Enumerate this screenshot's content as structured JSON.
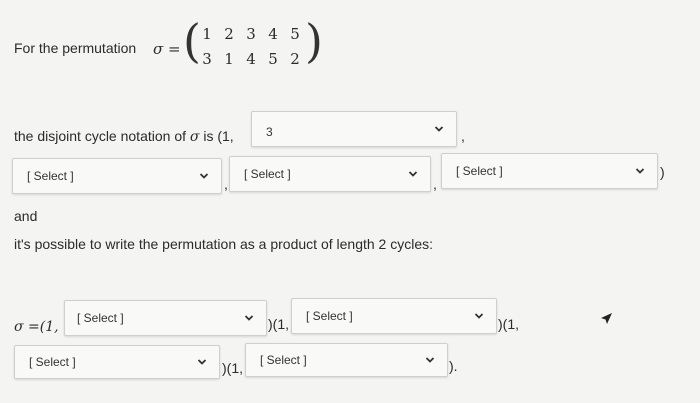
{
  "question": {
    "intro": "For the permutation",
    "sigma_eq": "σ =",
    "matrix_top": [
      "1",
      "2",
      "3",
      "4",
      "5"
    ],
    "matrix_bottom": [
      "3",
      "1",
      "4",
      "5",
      "2"
    ],
    "disjoint_prefix": "the disjoint cycle notation of",
    "disjoint_sigma": "σ",
    "disjoint_is": "is (1,",
    "and_text": "and",
    "product_text": "it's possible to write the permutation as a product of length 2 cycles:",
    "product_prefix": "σ =(1,"
  },
  "dropdowns": {
    "d1": "3",
    "d2": "[ Select ]",
    "d3": "[ Select ]",
    "d4": "[ Select ]",
    "p1": "[ Select ]",
    "p2": "[ Select ]",
    "p3": "[ Select ]",
    "p4": "[ Select ]"
  },
  "separators": {
    "comma": ",",
    "close_paren": ")",
    "cycle_join": ")(1,",
    "end": ")."
  }
}
